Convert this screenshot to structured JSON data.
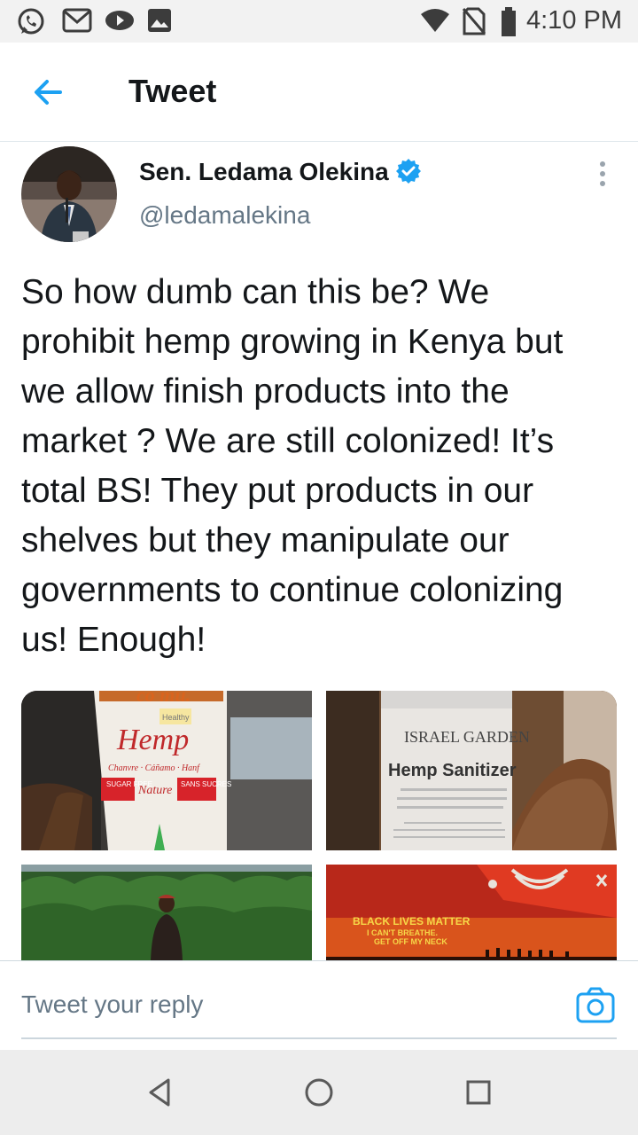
{
  "status_bar": {
    "time": "4:10 PM",
    "icons": [
      "whatsapp-icon",
      "gmail-icon",
      "youtube-icon",
      "gallery-icon",
      "wifi-icon",
      "no-sim-icon",
      "battery-icon"
    ]
  },
  "header": {
    "title": "Tweet",
    "back_icon": "arrow-left-icon"
  },
  "tweet": {
    "author_name": "Sen. Ledama Olekina",
    "author_handle": "@ledamalekina",
    "verified": true,
    "text": "So how dumb can this be? We prohibit hemp growing in Kenya but we allow finish products into the market ? We are still colonized! It’s total BS! They put products in our shelves but they manipulate our governments to continue colonizing us! Enough!",
    "media": [
      {
        "description_icon": "hemp-milk-carton-photo",
        "texts": [
          "Hemp",
          "Healthy",
          "Chanvre · Cáñamo · Hanf",
          "SUGAR FREE",
          "Nature",
          "SANS SUCRES"
        ]
      },
      {
        "description_icon": "hemp-sanitizer-bottle-photo",
        "texts": [
          "ISRAEL GARDEN",
          "Hemp Sanitizer"
        ]
      },
      {
        "description_icon": "hemp-field-photo",
        "texts": []
      },
      {
        "description_icon": "black-lives-matter-poster-photo",
        "texts": [
          "BLACK LIVES MATTER",
          "I CAN'T BREATHE.",
          "GET OFF MY NECK"
        ]
      }
    ]
  },
  "reply": {
    "placeholder": "Tweet your reply",
    "camera_icon": "camera-icon"
  },
  "nav_bar": {
    "buttons": [
      "back-triangle-icon",
      "home-circle-icon",
      "recents-square-icon"
    ]
  },
  "colors": {
    "accent": "#1da1f2",
    "text": "#14171a",
    "secondary_text": "#657786",
    "status_bar_bg": "#f2f2f2",
    "nav_bar_bg": "#ededed"
  }
}
